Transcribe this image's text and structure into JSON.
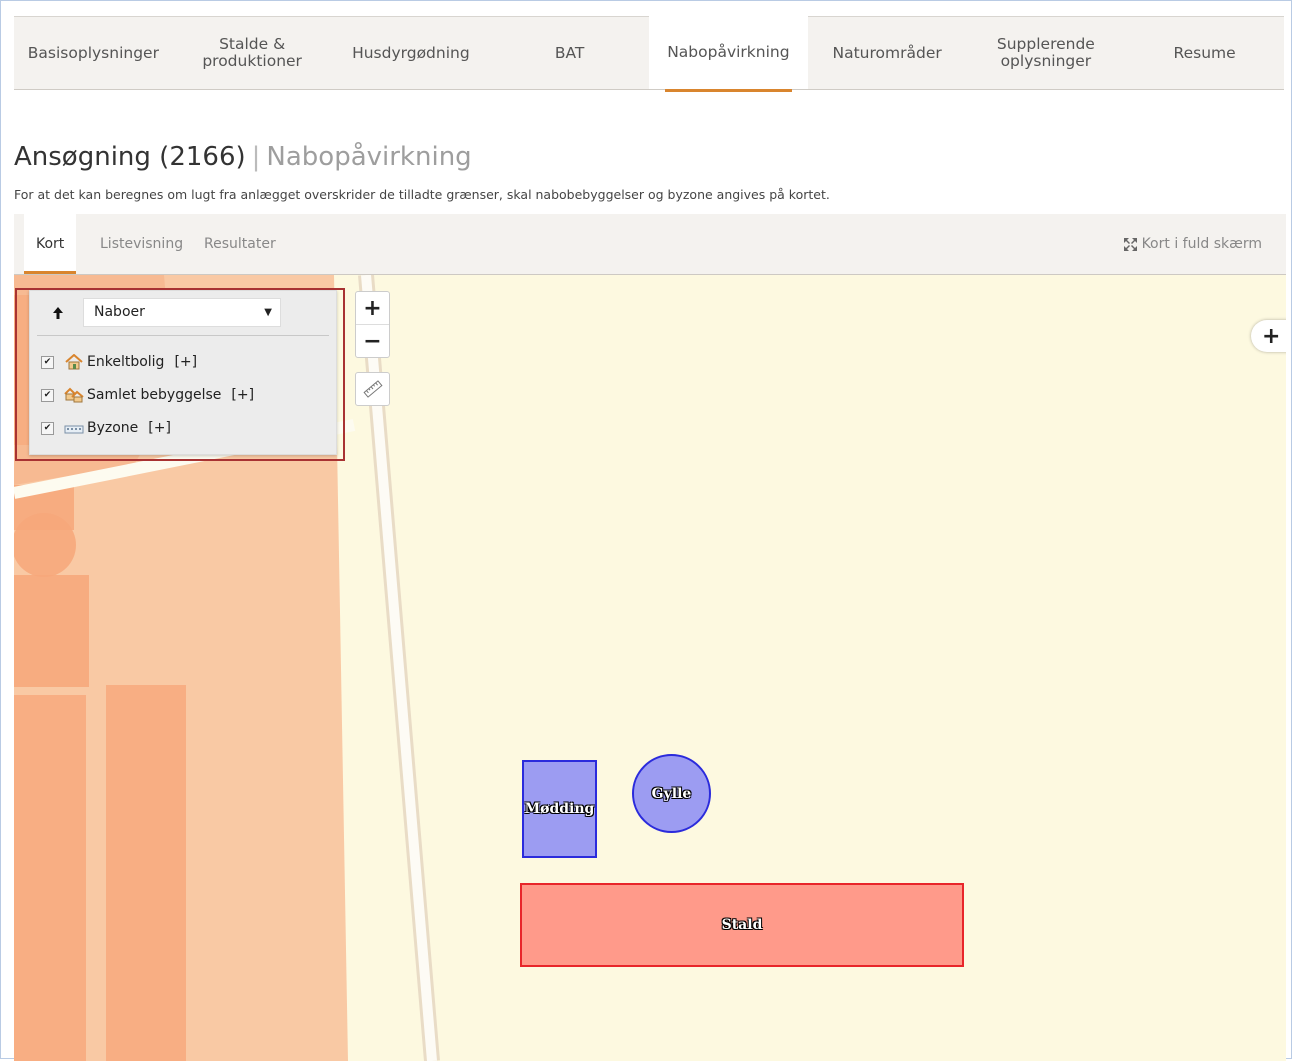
{
  "topnav": {
    "tabs": [
      {
        "label": "Basisoplysninger",
        "active": false
      },
      {
        "label": "Stalde &\nproduktioner",
        "active": false
      },
      {
        "label": "Husdyrgødning",
        "active": false
      },
      {
        "label": "BAT",
        "active": false
      },
      {
        "label": "Nabopåvirkning",
        "active": true
      },
      {
        "label": "Naturområder",
        "active": false
      },
      {
        "label": "Supplerende\noplysninger",
        "active": false
      },
      {
        "label": "Resume",
        "active": false
      }
    ],
    "accent_color": "#d9852e"
  },
  "page": {
    "title": "Ansøgning (2166)",
    "separator": "|",
    "subtitle": "Nabopåvirkning",
    "intro": "For at det kan beregnes om lugt fra anlægget overskrider de tilladte grænser, skal nabobebyggelser og byzone angives på kortet."
  },
  "subnav": {
    "tabs": [
      {
        "label": "Kort",
        "active": true
      },
      {
        "label": "Listevisning",
        "active": false
      },
      {
        "label": "Resultater",
        "active": false
      }
    ],
    "fullscreen_label": "Kort i fuld skærm"
  },
  "map": {
    "zoom_in": "+",
    "zoom_out": "−",
    "side_expand": "+",
    "layer_panel": {
      "selected_layer": "Naboer",
      "items": [
        {
          "label": "Enkeltbolig",
          "add": "[+]",
          "checked": true,
          "icon": "house-icon"
        },
        {
          "label": "Samlet bebyggelse",
          "add": "[+]",
          "checked": true,
          "icon": "houses-icon"
        },
        {
          "label": "Byzone",
          "add": "[+]",
          "checked": true,
          "icon": "city-zone-icon"
        }
      ]
    },
    "features": {
      "modding": "Mødding",
      "gylle": "Gylle",
      "stald": "Stald"
    },
    "colors": {
      "background": "#fdf9e0",
      "buildings": "#f7a77a",
      "storage_fill": "#9c9cf2",
      "storage_stroke": "#2b2bdc",
      "stable_fill": "#ff9a8a",
      "stable_stroke": "#e8262a"
    }
  }
}
